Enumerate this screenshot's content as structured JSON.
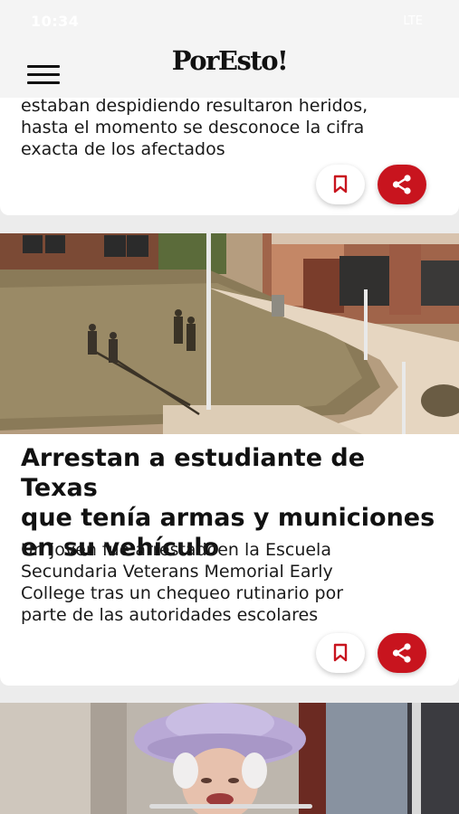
{
  "status_bar": {
    "time": "10:34",
    "right": "LTE"
  },
  "header": {
    "logo": "PorEsto!"
  },
  "articles": [
    {
      "summary_lines": [
        "estaban despidiendo resultaron heridos,",
        "hasta el momento se desconoce la cifra",
        "exacta de los afectados"
      ]
    },
    {
      "headline_lines": [
        "Arrestan a estudiante de Texas",
        "que tenía armas y municiones",
        "en su vehículo"
      ],
      "summary_lines": [
        "Un joven fue arrestadoen la Escuela",
        "Secundaria Veterans Memorial Early",
        "College tras un chequeo rutinario por",
        "parte de las autoridades escolares"
      ]
    }
  ],
  "icons": {
    "menu": "hamburger-menu-icon",
    "bookmark": "bookmark-icon",
    "share": "share-icon"
  },
  "colors": {
    "accent": "#c8141e",
    "background": "#ececec",
    "card": "#ffffff"
  }
}
